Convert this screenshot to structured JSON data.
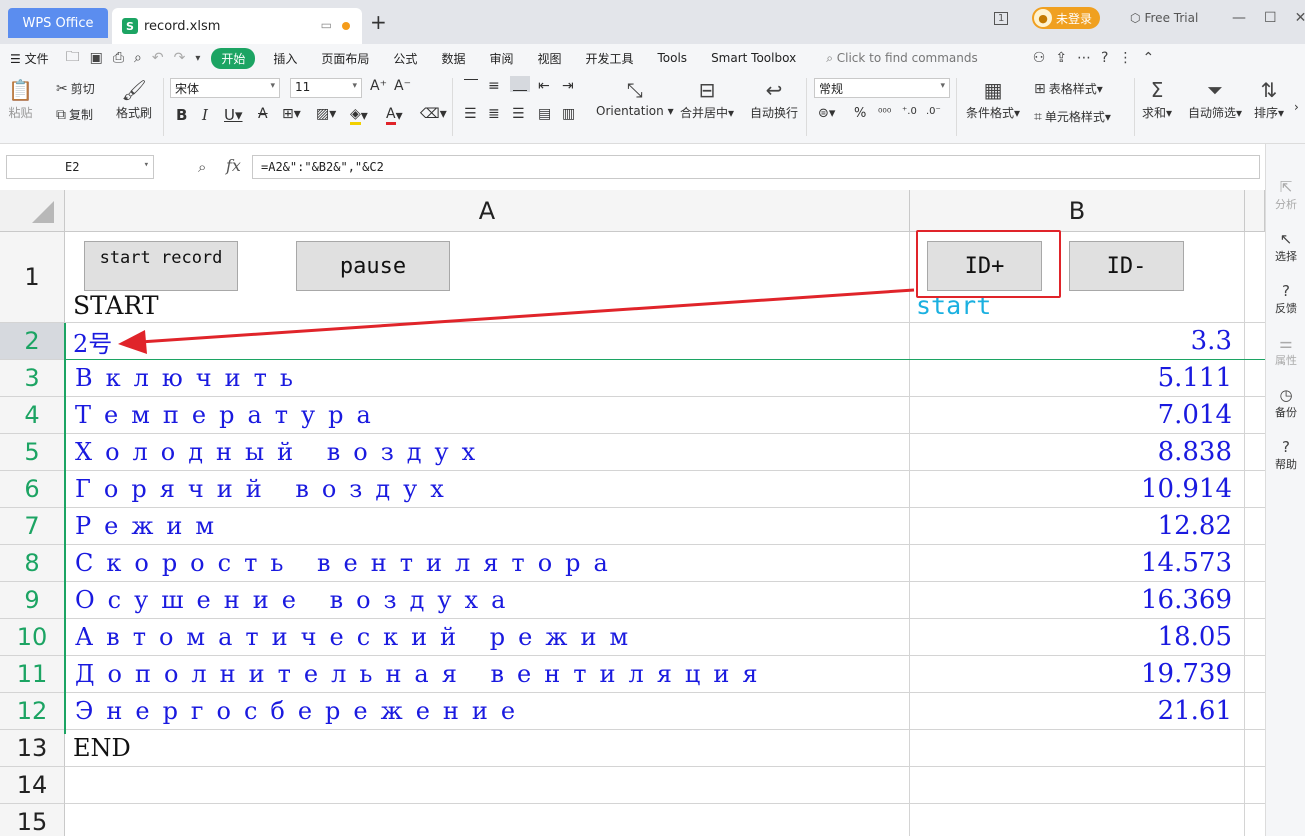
{
  "titlebar": {
    "app_tab": "WPS Office",
    "file_tab": "record.xlsm",
    "file_icon_letter": "S",
    "login": "未登录",
    "free_trial": "Free Trial",
    "page_indicator": "1"
  },
  "menu": {
    "file": "文件",
    "items": [
      "开始",
      "插入",
      "页面布局",
      "公式",
      "数据",
      "审阅",
      "视图",
      "开发工具",
      "Tools",
      "Smart Toolbox"
    ],
    "find_placeholder": "Click to find commands"
  },
  "ribbon": {
    "paste": "粘贴",
    "cut": "剪切",
    "copy": "复制",
    "format_painter": "格式刷",
    "font_name": "宋体",
    "font_size": "11",
    "orientation": "Orientation",
    "merge_center": "合并居中",
    "wrap_text": "自动换行",
    "number_format": "常规",
    "conditional_format": "条件格式",
    "table_style": "表格样式",
    "cell_style": "单元格样式",
    "sum": "求和",
    "auto_filter": "自动筛选",
    "sort": "排序"
  },
  "formula_bar": {
    "name_box": "E2",
    "fx": "fx",
    "formula": "=A2&\":\"&B2&\",\"&C2"
  },
  "side_panel": [
    "分析",
    "选择",
    "反馈",
    "属性",
    "备份",
    "帮助"
  ],
  "sheet": {
    "columns": [
      "A",
      "B"
    ],
    "buttons": {
      "start_record": "start record",
      "pause": "pause",
      "id_plus": "ID+",
      "id_minus": "ID-"
    },
    "rows": [
      {
        "num": "1",
        "a": "START",
        "b": "start"
      },
      {
        "num": "2",
        "a": "2号",
        "b": "3.3"
      },
      {
        "num": "3",
        "a": "Включить",
        "b": "5.111"
      },
      {
        "num": "4",
        "a": "Температура",
        "b": "7.014"
      },
      {
        "num": "5",
        "a": "Холодный воздух",
        "b": "8.838"
      },
      {
        "num": "6",
        "a": "Горячий воздух",
        "b": "10.914"
      },
      {
        "num": "7",
        "a": "Режим",
        "b": "12.82"
      },
      {
        "num": "8",
        "a": "Скорость вентилятора",
        "b": "14.573"
      },
      {
        "num": "9",
        "a": "Осушение воздуха",
        "b": "16.369"
      },
      {
        "num": "10",
        "a": "Автоматический режим",
        "b": "18.05"
      },
      {
        "num": "11",
        "a": "Дополнительная вентиляция",
        "b": "19.739"
      },
      {
        "num": "12",
        "a": "Энергосбережение",
        "b": "21.61"
      },
      {
        "num": "13",
        "a": "END",
        "b": ""
      },
      {
        "num": "14",
        "a": "",
        "b": ""
      },
      {
        "num": "15",
        "a": "",
        "b": ""
      }
    ]
  },
  "colors": {
    "accent_green": "#1ca463",
    "wps_blue": "#5b8def",
    "cell_blue": "#1a1adf",
    "annotation_red": "#e0242a",
    "start_cyan": "#1ab0e0"
  }
}
